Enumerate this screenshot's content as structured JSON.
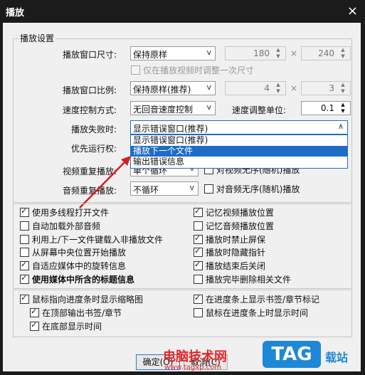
{
  "window": {
    "title": "播放",
    "close_icon": "×"
  },
  "group_playback": {
    "legend": "播放设置",
    "window_size": {
      "label": "播放窗口尺寸:",
      "value": "保持原样",
      "width": "180",
      "height": "240",
      "sep": "×"
    },
    "resize_once": {
      "label": "仅在播放视频时调整一次尺寸",
      "checked": false,
      "enabled": false
    },
    "aspect": {
      "label": "播放窗口比例:",
      "value": "保持原样(推荐)",
      "w": "4",
      "h": "3",
      "sep": "×"
    },
    "speed_mode": {
      "label": "速度控制方式:",
      "value": "无回音速度控制"
    },
    "speed_unit": {
      "label": "速度调整单位:",
      "value": "0.1"
    },
    "fail": {
      "label": "播放失败时:",
      "value": "显示错误窗口(推荐)",
      "options": [
        "显示错误窗口(推荐)",
        "播放下一个文件",
        "输出错误信息"
      ],
      "selected_index": 1
    },
    "priority": {
      "label": "优先运行权:"
    },
    "video_repeat": {
      "label": "视频重复播放:",
      "value": "单个循环",
      "extra": "对视频无序(随机)播放"
    },
    "audio_repeat": {
      "label": "音频重复播放:",
      "value": "不循环",
      "extra": "对音频无序(随机)播放"
    }
  },
  "options_left": [
    {
      "label": "使用多线程打开文件",
      "checked": true,
      "bold": false
    },
    {
      "label": "自动加载外部音频",
      "checked": false,
      "bold": false
    },
    {
      "label": "利用上/下一文件键载入非播放文件",
      "checked": false,
      "bold": false
    },
    {
      "label": "从屏幕中央位置开始播放",
      "checked": false,
      "bold": false
    },
    {
      "label": "自适应媒体中的旋转信息",
      "checked": true,
      "bold": false
    },
    {
      "label": "使用媒体中所含的标题信息",
      "checked": true,
      "bold": true
    }
  ],
  "options_right": [
    {
      "label": "记忆视频播放位置",
      "checked": true
    },
    {
      "label": "记忆音频播放位置",
      "checked": false
    },
    {
      "label": "播放时禁止屏保",
      "checked": true
    },
    {
      "label": "播放时隐藏指针",
      "checked": true
    },
    {
      "label": "播放结束后关闭",
      "checked": true
    },
    {
      "label": "播放完毕删除相关文件",
      "checked": false
    }
  ],
  "progress_left": [
    {
      "label": "鼠标指向进度条时显示缩略图",
      "checked": true
    },
    {
      "label": "在顶部输出书签/章节",
      "checked": true
    },
    {
      "label": "在底部显示时间",
      "checked": true
    }
  ],
  "progress_right": [
    {
      "label": "在进度条上显示书签/章节标记",
      "checked": true
    },
    {
      "label": "鼠标在进度条上时显示时间",
      "checked": false
    }
  ],
  "buttons": {
    "ok": "确定(O)",
    "cancel": "取消(C)"
  },
  "watermark": {
    "text": "电脑技术网",
    "url": "www.tagxp.com",
    "logo": "TAG",
    "side": "载站"
  },
  "colors": {
    "accent": "#1e6cc8",
    "title_bg": "#1b1b1b",
    "dialog_bg": "#f0f0f0",
    "arrow": "#d32020",
    "watermark_red": "#e8262c",
    "watermark_blue": "#1e88d6"
  }
}
